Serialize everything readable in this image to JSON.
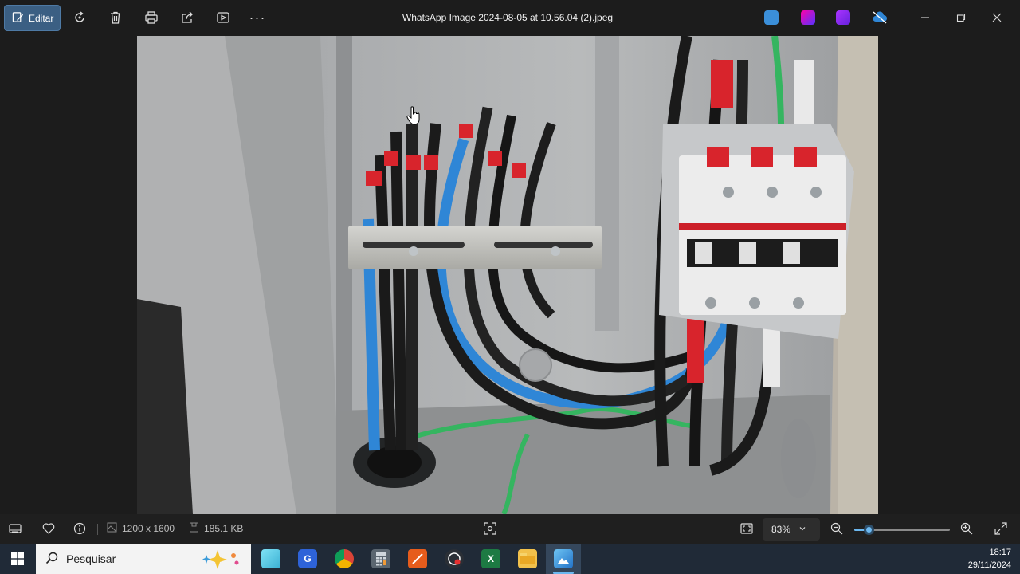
{
  "window": {
    "title": "WhatsApp Image 2024-08-05 at 10.56.04 (2).jpeg"
  },
  "toolbar": {
    "edit_label": "Editar",
    "icons": [
      "rotate-icon",
      "delete-icon",
      "print-icon",
      "share-icon",
      "slideshow-icon",
      "more-icon"
    ]
  },
  "statusbar": {
    "dimensions": "1200 x 1600",
    "file_size": "185.1 KB",
    "zoom": "83%",
    "zoom_level": 0.15
  },
  "taskbar": {
    "search_placeholder": "Pesquisar",
    "time": "18:17",
    "date": "29/11/2024"
  },
  "colors": {
    "accent": "#3b5f83",
    "slider": "#6cb8f0",
    "taskbar": "#202a37"
  }
}
